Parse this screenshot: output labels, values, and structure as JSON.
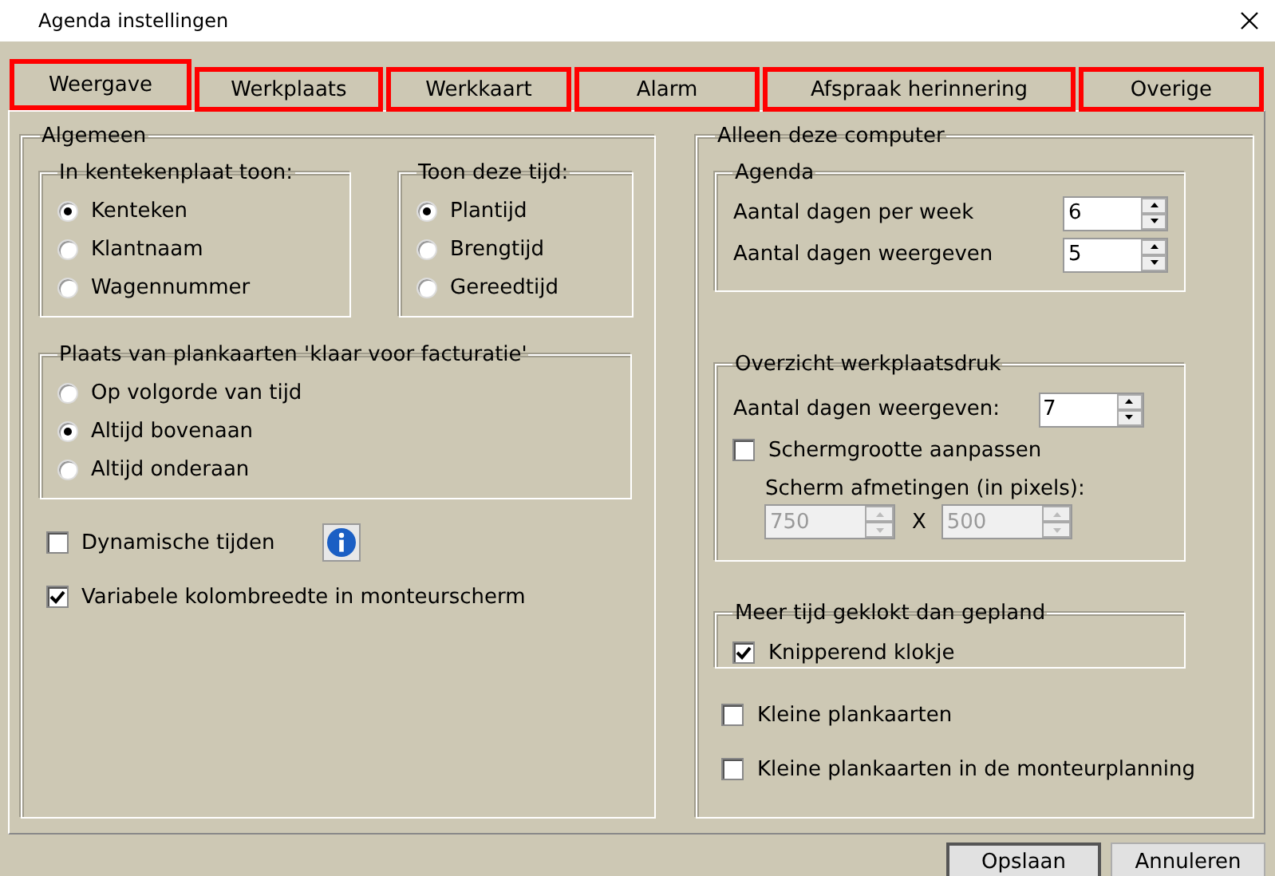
{
  "window": {
    "title": "Agenda instellingen"
  },
  "tabs": [
    {
      "label": "Weergave",
      "selected": true
    },
    {
      "label": "Werkplaats",
      "selected": false
    },
    {
      "label": "Werkkaart",
      "selected": false
    },
    {
      "label": "Alarm",
      "selected": false
    },
    {
      "label": "Afspraak herinnering",
      "selected": false
    },
    {
      "label": "Overige",
      "selected": false
    }
  ],
  "general": {
    "legend": "Algemeen",
    "plate_group": {
      "legend": "In kentekenplaat toon:",
      "options": [
        {
          "label": "Kenteken",
          "selected": true
        },
        {
          "label": "Klantnaam",
          "selected": false
        },
        {
          "label": "Wagennummer",
          "selected": false
        }
      ]
    },
    "time_group": {
      "legend": "Toon deze tijd:",
      "options": [
        {
          "label": "Plantijd",
          "selected": true
        },
        {
          "label": "Brengtijd",
          "selected": false
        },
        {
          "label": "Gereedtijd",
          "selected": false
        }
      ]
    },
    "placement_group": {
      "legend": "Plaats van plankaarten 'klaar voor facturatie'",
      "options": [
        {
          "label": "Op volgorde van tijd",
          "selected": false
        },
        {
          "label": "Altijd bovenaan",
          "selected": true
        },
        {
          "label": "Altijd onderaan",
          "selected": false
        }
      ]
    },
    "checks": [
      {
        "label": "Dynamische tijden",
        "checked": false,
        "info": true
      },
      {
        "label": "Variabele kolombreedte in monteurscherm",
        "checked": true,
        "info": false
      }
    ]
  },
  "computer": {
    "legend": "Alleen deze computer",
    "agenda": {
      "legend": "Agenda",
      "fields": [
        {
          "label": "Aantal dagen per week",
          "value": "6"
        },
        {
          "label": "Aantal dagen weergeven",
          "value": "5"
        }
      ]
    },
    "overview": {
      "legend": "Overzicht werkplaatsdruk",
      "field": {
        "label": "Aantal dagen weergeven:",
        "value": "7"
      },
      "resize": {
        "label": "Schermgrootte aanpassen",
        "checked": false
      },
      "size_label": "Scherm afmetingen (in pixels):",
      "size_fields": [
        {
          "value": "750",
          "disabled": true
        },
        {
          "value": "500",
          "disabled": true
        }
      ],
      "separator": "X"
    },
    "overtime": {
      "legend": "Meer tijd geklokt dan gepland",
      "check": {
        "label": "Knipperend klokje",
        "checked": true
      }
    },
    "checks": [
      {
        "label": "Kleine plankaarten",
        "checked": false
      },
      {
        "label": "Kleine plankaarten in de monteurplanning",
        "checked": false
      }
    ]
  },
  "buttons": [
    "Opslaan",
    "Annuleren"
  ]
}
